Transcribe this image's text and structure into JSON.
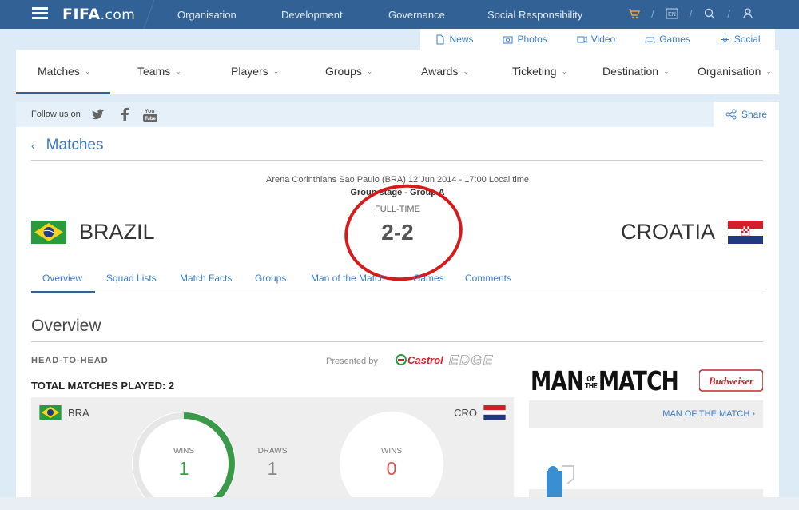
{
  "topbar": {
    "logo_main": "FIFA",
    "logo_suffix": ".com",
    "nav": [
      "Organisation",
      "Development",
      "Governance",
      "Social Responsibility"
    ],
    "icons": [
      "cart-icon",
      "language-icon",
      "search-icon",
      "user-icon"
    ],
    "language_code": "EN"
  },
  "subbar": {
    "items": [
      "News",
      "Photos",
      "Video",
      "Games",
      "Social"
    ]
  },
  "mainnav": {
    "items": [
      "Matches",
      "Teams",
      "Players",
      "Groups",
      "Awards",
      "Ticketing",
      "Destination",
      "Organisation"
    ],
    "active": "Matches"
  },
  "follow": {
    "label": "Follow us on",
    "share": "Share"
  },
  "page": {
    "back_label": "Matches"
  },
  "match": {
    "venue": "Arena Corinthians Sao Paulo (BRA) 12 Jun 2014 - 17:00 Local time",
    "stage": "Group stage - Group A",
    "status": "FULL-TIME",
    "score": "2-2",
    "home": "BRAZIL",
    "away": "CROATIA"
  },
  "tabs": [
    "Overview",
    "Squad Lists",
    "Match Facts",
    "Groups",
    "Man of the Match",
    "Games",
    "Comments"
  ],
  "overview": {
    "title": "Overview",
    "h2h_label": "HEAD-TO-HEAD",
    "presented_by": "Presented by",
    "sponsor": "Castrol EDGE",
    "total": "TOTAL MATCHES PLAYED: 2",
    "home_code": "BRA",
    "away_code": "CRO",
    "stats": [
      {
        "label": "WINS",
        "value": "1",
        "color": "#3a9a4a"
      },
      {
        "label": "DRAWS",
        "value": "1",
        "color": "#888888"
      },
      {
        "label": "WINS",
        "value": "0",
        "color": "#d9534f"
      }
    ],
    "home_win_fraction": 0.5
  },
  "motm": {
    "title_left": "MAN",
    "title_small_top": "OF",
    "title_small_bottom": "THE",
    "title_right": "MATCH",
    "sponsor": "Budweiser",
    "link": "MAN OF THE MATCH ›"
  },
  "colors": {
    "header_blue": "#326295",
    "link_blue": "#3a7bc8",
    "annotation_red": "#d41c1c"
  }
}
